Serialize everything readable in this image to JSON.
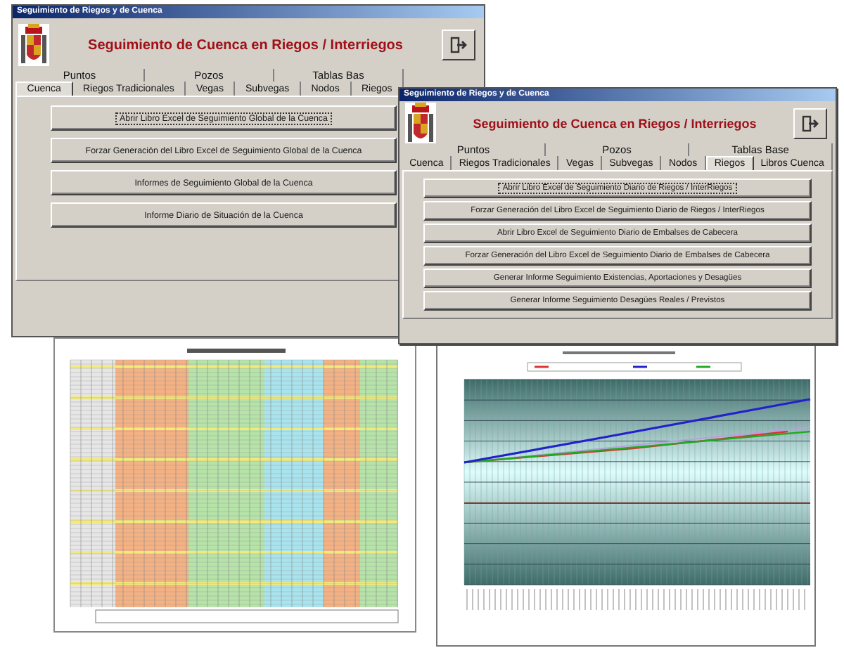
{
  "windows": [
    {
      "title": "Seguimiento de Riegos y de Cuenca",
      "header": "Seguimiento de Cuenca en Riegos / Interriegos",
      "tab_rows": [
        [
          {
            "label": "Puntos",
            "selected": false
          },
          {
            "label": "Pozos",
            "selected": false
          },
          {
            "label": "Tablas Bas",
            "selected": false
          }
        ],
        [
          {
            "label": "Cuenca",
            "selected": true
          },
          {
            "label": "Riegos Tradicionales",
            "selected": false
          },
          {
            "label": "Vegas",
            "selected": false
          },
          {
            "label": "Subvegas",
            "selected": false
          },
          {
            "label": "Nodos",
            "selected": false
          },
          {
            "label": "Riegos",
            "selected": false
          }
        ]
      ],
      "buttons": [
        {
          "label": "Abrir Libro Excel de Seguimiento Global de la Cuenca",
          "focused": true
        },
        {
          "label": "Forzar Generación del Libro Excel de Seguimiento Global de la Cuenca",
          "focused": false
        },
        {
          "label": "Informes de Seguimiento Global de la Cuenca",
          "focused": false
        },
        {
          "label": "Informe Diario de Situación de la Cuenca",
          "focused": false
        }
      ]
    },
    {
      "title": "Seguimiento de Riegos y de Cuenca",
      "header": "Seguimiento de Cuenca en Riegos / Interriegos",
      "tab_rows": [
        [
          {
            "label": "Puntos",
            "selected": false
          },
          {
            "label": "Pozos",
            "selected": false
          },
          {
            "label": "Tablas Base",
            "selected": false
          }
        ],
        [
          {
            "label": "Cuenca",
            "selected": false
          },
          {
            "label": "Riegos Tradicionales",
            "selected": false
          },
          {
            "label": "Vegas",
            "selected": false
          },
          {
            "label": "Subvegas",
            "selected": false
          },
          {
            "label": "Nodos",
            "selected": false
          },
          {
            "label": "Riegos",
            "selected": true
          },
          {
            "label": "Libros Cuenca",
            "selected": false
          }
        ]
      ],
      "buttons": [
        {
          "label": "Abrir Libro Excel de Seguimiento Diario de Riegos / InterRiegos",
          "focused": true
        },
        {
          "label": "Forzar Generación del Libro Excel de Seguimiento Diario de Riegos / InterRiegos",
          "focused": false
        },
        {
          "label": "Abrir Libro Excel de Seguimiento Diario de Embalses de Cabecera",
          "focused": false
        },
        {
          "label": "Forzar Generación del Libro Excel de Seguimiento Diario de Embalses de Cabecera",
          "focused": false
        },
        {
          "label": "Generar Informe Seguimiento Existencias, Aportaciones y Desagües",
          "focused": false
        },
        {
          "label": "Generar Informe Seguimiento Desagües Reales / Previstos",
          "focused": false
        }
      ]
    }
  ]
}
